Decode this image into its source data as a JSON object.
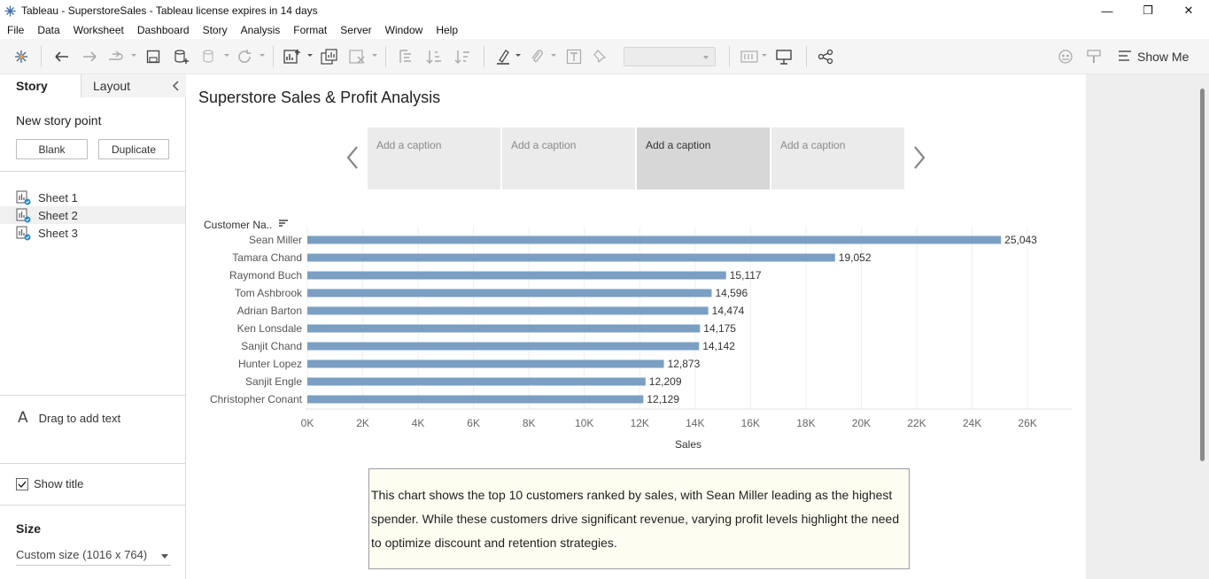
{
  "window": {
    "title": "Tableau - SuperstoreSales - Tableau license expires in 14 days",
    "controls": {
      "minimize": "—",
      "maximize": "❐",
      "close": "✕"
    }
  },
  "menu": [
    "File",
    "Data",
    "Worksheet",
    "Dashboard",
    "Story",
    "Analysis",
    "Format",
    "Server",
    "Window",
    "Help"
  ],
  "toolbar": {
    "show_me_label": "Show Me",
    "icons": [
      "tableau-logo-icon",
      "undo-icon",
      "redo-icon",
      "replay-icon",
      "save-icon",
      "new-data-source-icon",
      "pause-updates-icon",
      "refresh-icon",
      "new-worksheet-icon",
      "duplicate-sheet-icon",
      "clear-sheet-icon",
      "swap-rows-columns-icon",
      "sort-ascending-icon",
      "sort-descending-icon",
      "highlight-icon",
      "group-members-icon",
      "show-labels-icon",
      "fix-axes-icon",
      "fit-dropdown",
      "show-cards-icon",
      "presentation-mode-icon",
      "share-icon",
      "tableau-assistant-icon",
      "format-painter-icon"
    ]
  },
  "left_pane": {
    "tabs": {
      "story": "Story",
      "layout": "Layout"
    },
    "new_story_point": "New story point",
    "buttons": {
      "blank": "Blank",
      "duplicate": "Duplicate"
    },
    "sheets": [
      "Sheet 1",
      "Sheet 2",
      "Sheet 3"
    ],
    "selected_sheet": "Sheet 2",
    "drag_text_icon": "A",
    "drag_text": "Drag to add text",
    "show_title_label": "Show title",
    "show_title_checked": true,
    "size_heading": "Size",
    "size_value": "Custom size (1016 x 764)"
  },
  "story": {
    "title": "Superstore Sales & Profit Analysis",
    "captions": [
      "Add a caption",
      "Add a caption",
      "Add a caption",
      "Add a caption"
    ],
    "active_caption_index": 2,
    "text_box": "This chart shows the top 10 customers ranked by sales, with Sean Miller leading as the highest spender. While these customers drive significant revenue, varying profit levels highlight the need to optimize discount and retention strategies."
  },
  "chart_data": {
    "type": "bar",
    "orientation": "horizontal",
    "row_header": "Customer Na..",
    "categories": [
      "Sean Miller",
      "Tamara Chand",
      "Raymond Buch",
      "Tom Ashbrook",
      "Adrian Barton",
      "Ken Lonsdale",
      "Sanjit Chand",
      "Hunter Lopez",
      "Sanjit Engle",
      "Christopher Conant"
    ],
    "values": [
      25043,
      19052,
      15117,
      14596,
      14474,
      14175,
      14142,
      12873,
      12209,
      12129
    ],
    "value_labels": [
      "25,043",
      "19,052",
      "15,117",
      "14,596",
      "14,474",
      "14,175",
      "14,142",
      "12,873",
      "12,209",
      "12,129"
    ],
    "xlabel": "Sales",
    "ticks": [
      0,
      2000,
      4000,
      6000,
      8000,
      10000,
      12000,
      14000,
      16000,
      18000,
      20000,
      22000,
      24000,
      26000
    ],
    "tick_labels": [
      "0K",
      "2K",
      "4K",
      "6K",
      "8K",
      "10K",
      "12K",
      "14K",
      "16K",
      "18K",
      "20K",
      "22K",
      "24K",
      "26K"
    ],
    "xlim": [
      0,
      27500
    ],
    "grid": true,
    "bar_color": "#7a9fc3"
  }
}
